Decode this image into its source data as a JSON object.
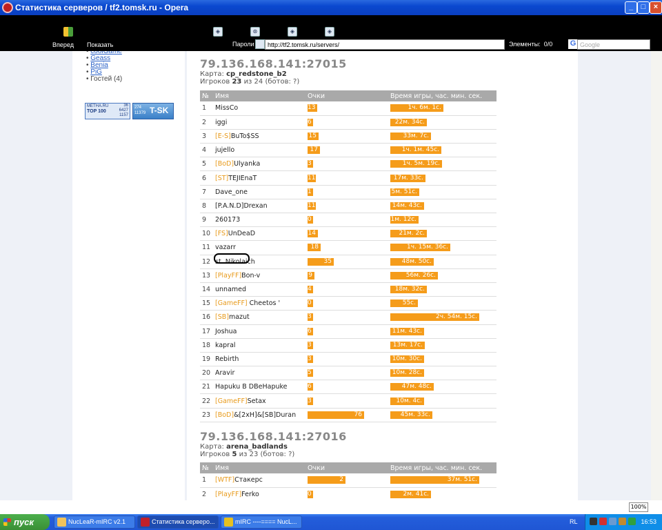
{
  "window": {
    "title": "Статистика серверов / tf2.tomsk.ru - Opera",
    "buttons": {
      "minimize": "_",
      "maximize": "□",
      "close": "×"
    }
  },
  "toolbar": {
    "forward_label": "Вперед",
    "show_label": "Показать",
    "passwords_label": "Пароли",
    "address": "http://tf2.tomsk.ru/servers/",
    "elements_label": "Элементы:",
    "elements_value": "0/0",
    "search_placeholder": "Google"
  },
  "sidebar": {
    "items": [
      {
        "label": "coolGame",
        "link": true
      },
      {
        "label": "Geass",
        "link": true
      },
      {
        "label": "Benia",
        "link": true
      },
      {
        "label": "PiG",
        "link": true
      },
      {
        "label": "Гостей (4)",
        "link": false
      }
    ],
    "banner1": {
      "site": "METHA.RU",
      "title": "TOP 100",
      "n1": "36",
      "n2": "6427",
      "n3": "1157"
    },
    "banner2": {
      "n1": "274",
      "n2": "11379",
      "logo": "T-SK"
    }
  },
  "servers": [
    {
      "address": "79.136.168.141:27015",
      "map_label": "Карта:",
      "map": "cp_redstone_b2",
      "players_prefix": "Игроков",
      "players_count": "23",
      "players_suffix": "из 24 (ботов: ?)",
      "columns": [
        "№",
        "Имя",
        "Очки",
        "Время игры, час. мин. сек."
      ],
      "rows": [
        {
          "n": "1",
          "tag": "",
          "name": "MissCo",
          "score": 13,
          "time": "1ч. 6м. 1с.",
          "time_frac": 0.58
        },
        {
          "n": "2",
          "tag": "",
          "name": "iggi",
          "score": 6,
          "time": "22м. 34с.",
          "time_frac": 0.4
        },
        {
          "n": "3",
          "tag": "[E-S]",
          "name": "BuTo$SS",
          "score": 15,
          "time": "33м. 7с.",
          "time_frac": 0.45
        },
        {
          "n": "4",
          "tag": "",
          "name": "jujello",
          "score": 17,
          "time": "1ч. 1м. 45с.",
          "time_frac": 0.56
        },
        {
          "n": "5",
          "tag": "[BoD]",
          "name": "Ulyanka",
          "score": 3,
          "time": "1ч. 5м. 19с.",
          "time_frac": 0.57
        },
        {
          "n": "6",
          "tag": "[ST]",
          "name": "TEJIEnaT",
          "score": 11,
          "time": "17м. 33с.",
          "time_frac": 0.39
        },
        {
          "n": "7",
          "tag": "",
          "name": "Dave_one",
          "score": 1,
          "time": "5м. 51с.",
          "time_frac": 0.32
        },
        {
          "n": "8",
          "tag": "",
          "name": "[P.A.N.D]Drexan",
          "score": 11,
          "time": "14м. 43с.",
          "time_frac": 0.37
        },
        {
          "n": "9",
          "tag": "",
          "name": "260173",
          "score": 0,
          "time": "1м. 12с.",
          "time_frac": 0.31
        },
        {
          "n": "10",
          "tag": "[FS]",
          "name": "UnDeaD",
          "score": 14,
          "time": "21м. 2с.",
          "time_frac": 0.4
        },
        {
          "n": "11",
          "tag": "",
          "name": "vazarr",
          "score": 18,
          "time": "1ч. 15м. 36с.",
          "time_frac": 0.66
        },
        {
          "n": "12",
          "tag": "",
          "name": "st. Nikolaich",
          "score": 35,
          "time": "48м. 50с.",
          "time_frac": 0.48
        },
        {
          "n": "13",
          "tag": "[PlayFF]",
          "name": "Bon-v",
          "score": 9,
          "time": "56м. 26с.",
          "time_frac": 0.52
        },
        {
          "n": "14",
          "tag": "",
          "name": "unnamed",
          "score": 4,
          "time": "18м. 32с.",
          "time_frac": 0.4
        },
        {
          "n": "15",
          "tag": "[GameFF]",
          "name": " Cheetos '",
          "score": 0,
          "time": "55с.",
          "time_frac": 0.3
        },
        {
          "n": "16",
          "tag": "[SB]",
          "name": "mazut",
          "score": 3,
          "time": "2ч. 54м. 15с.",
          "time_frac": 0.98
        },
        {
          "n": "17",
          "tag": "",
          "name": "Joshua",
          "score": 6,
          "time": "11м. 43с.",
          "time_frac": 0.37
        },
        {
          "n": "18",
          "tag": "",
          "name": "kapral",
          "score": 3,
          "time": "13м. 17с.",
          "time_frac": 0.38
        },
        {
          "n": "19",
          "tag": "",
          "name": "Rebirth",
          "score": 3,
          "time": "10м. 30с.",
          "time_frac": 0.37
        },
        {
          "n": "20",
          "tag": "",
          "name": "Aravir",
          "score": 5,
          "time": "10м. 28с.",
          "time_frac": 0.37
        },
        {
          "n": "21",
          "tag": "",
          "name": "Hapuku B DBeHapuke",
          "score": 6,
          "time": "47м. 48с.",
          "time_frac": 0.48
        },
        {
          "n": "22",
          "tag": "[GameFF]",
          "name": "Setax",
          "score": 3,
          "time": "10м. 4с.",
          "time_frac": 0.37
        },
        {
          "n": "23",
          "tag": "[BoD]",
          "name": "&[2xH]&[SB]Duran",
          "score": 76,
          "time": "45м. 33с.",
          "time_frac": 0.46
        }
      ]
    },
    {
      "address": "79.136.168.141:27016",
      "map_label": "Карта:",
      "map": "arena_badlands",
      "players_prefix": "Игроков",
      "players_count": "5",
      "players_suffix": "из 23 (ботов: ?)",
      "columns": [
        "№",
        "Имя",
        "Очки",
        "Время игры, час. мин. сек."
      ],
      "rows": [
        {
          "n": "1",
          "tag": "[WTF]",
          "name": "Стакерс",
          "score": 2,
          "score_frac": 0.67,
          "time": "37м. 51с.",
          "time_frac": 0.98
        },
        {
          "n": "2",
          "tag": "[PlayFF]",
          "name": "Ferko",
          "score": 0,
          "time": "2м. 41с.",
          "time_frac": 0.45
        }
      ]
    }
  ],
  "status": {
    "zoom": "100%"
  },
  "taskbar": {
    "start_label": "пуск",
    "tasks": [
      "NucLeaR-mIRC v2.1",
      "Статистика серверо...",
      "mIRC ----==== NucL..."
    ],
    "lang": "RL",
    "clock": "16:53"
  },
  "colors": {
    "bar": "#f59c1a",
    "tag": "#e89a1a",
    "header": "#a9a9a9"
  }
}
